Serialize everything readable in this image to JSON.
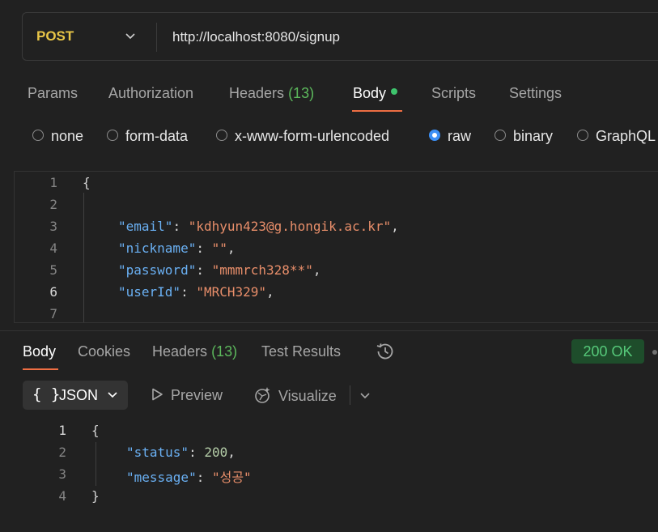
{
  "request": {
    "method": "POST",
    "url": "http://localhost:8080/signup"
  },
  "request_tabs": [
    {
      "label": "Params"
    },
    {
      "label": "Authorization"
    },
    {
      "label": "Headers",
      "count": "(13)"
    },
    {
      "label": "Body"
    },
    {
      "label": "Scripts"
    },
    {
      "label": "Settings"
    }
  ],
  "body_types": {
    "selected": "raw",
    "options": [
      "none",
      "form-data",
      "x-www-form-urlencoded",
      "raw",
      "binary",
      "GraphQL"
    ]
  },
  "request_body": {
    "line_numbers": [
      "1",
      "2",
      "3",
      "4",
      "5",
      "6",
      "7"
    ],
    "open_brace": "{",
    "fields": [
      {
        "key": "\"email\"",
        "value": "\"kdhyun423@g.hongik.ac.kr\""
      },
      {
        "key": "\"nickname\"",
        "value": "\"\""
      },
      {
        "key": "\"password\"",
        "value": "\"mmmrch328**\""
      },
      {
        "key": "\"userId\"",
        "value": "\"MRCH329\""
      }
    ]
  },
  "response_tabs": [
    {
      "label": "Body"
    },
    {
      "label": "Cookies"
    },
    {
      "label": "Headers",
      "count": "(13)"
    },
    {
      "label": "Test Results"
    }
  ],
  "response_status": "200 OK",
  "response_toolbar": {
    "format_brace": "{ }",
    "format_label": "JSON",
    "preview_label": "Preview",
    "visualize_label": "Visualize"
  },
  "response_body": {
    "line_numbers": [
      "1",
      "2",
      "3",
      "4"
    ],
    "open_brace": "{",
    "close_brace": "}",
    "status_key": "\"status\"",
    "status_value": "200",
    "message_key": "\"message\"",
    "message_value": "\"성공\""
  },
  "colors": {
    "background": "#212121",
    "method": "#e8c547",
    "accent_underline": "#ee6e43",
    "json_key": "#6ab0f3",
    "json_string": "#e88e6a",
    "json_number": "#b5cea8",
    "status_ok": "#56c97a"
  },
  "icons": [
    "chevron-down-icon",
    "history-icon",
    "play-icon",
    "visualize-icon"
  ]
}
